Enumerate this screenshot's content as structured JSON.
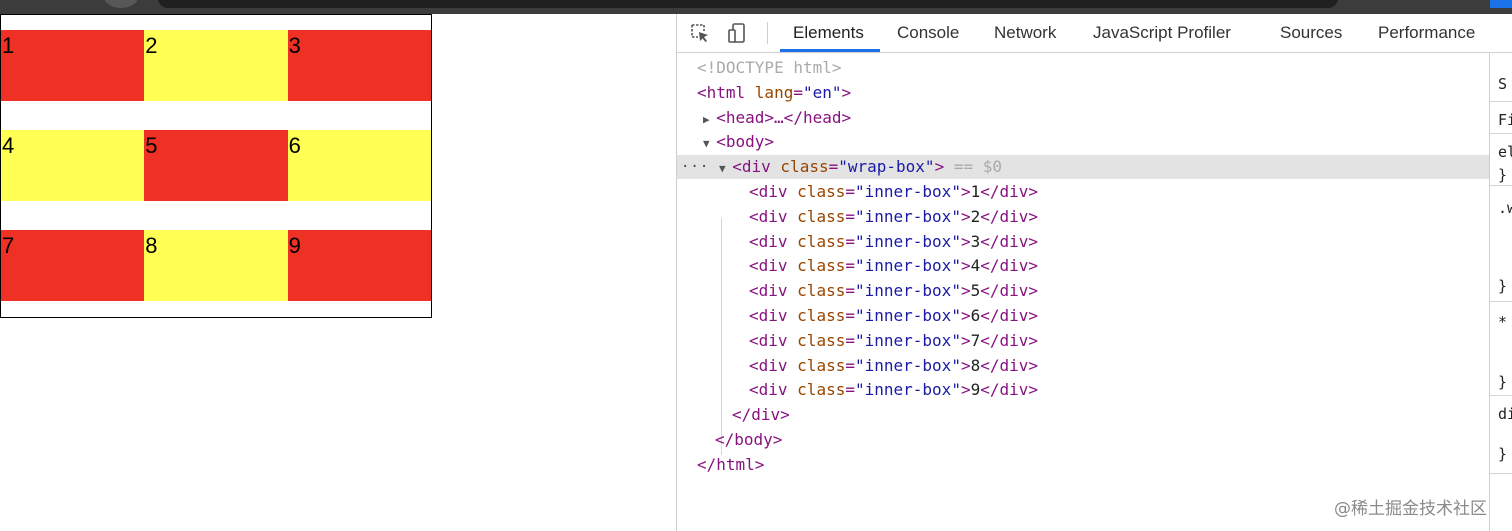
{
  "preview": {
    "rows": [
      [
        {
          "label": "1",
          "color": "red"
        },
        {
          "label": "2",
          "color": "yellow"
        },
        {
          "label": "3",
          "color": "red"
        }
      ],
      [
        {
          "label": "4",
          "color": "yellow"
        },
        {
          "label": "5",
          "color": "red"
        },
        {
          "label": "6",
          "color": "yellow"
        }
      ],
      [
        {
          "label": "7",
          "color": "red"
        },
        {
          "label": "8",
          "color": "yellow"
        },
        {
          "label": "9",
          "color": "red"
        }
      ]
    ],
    "colors": {
      "red": "#ee3124",
      "yellow": "#ffff54"
    }
  },
  "devtools": {
    "tabs": [
      {
        "label": "Elements",
        "active": true
      },
      {
        "label": "Console"
      },
      {
        "label": "Network"
      },
      {
        "label": "JavaScript Profiler"
      },
      {
        "label": "Sources"
      },
      {
        "label": "Performance"
      }
    ],
    "toolbar_icons": [
      "inspect-element-icon",
      "device-toolbar-icon"
    ],
    "dom": {
      "doctype": "<!DOCTYPE html>",
      "html_open": {
        "tag": "html",
        "attr": "lang",
        "value": "\"en\""
      },
      "head": "<head>…</head>",
      "body_open": "<body>",
      "wrap_div": {
        "tag": "div",
        "attr": "class",
        "value": "\"wrap-box\"",
        "marker": "== $0"
      },
      "children": [
        {
          "tag": "div",
          "attr": "class",
          "value": "\"inner-box\"",
          "text": "1"
        },
        {
          "tag": "div",
          "attr": "class",
          "value": "\"inner-box\"",
          "text": "2"
        },
        {
          "tag": "div",
          "attr": "class",
          "value": "\"inner-box\"",
          "text": "3"
        },
        {
          "tag": "div",
          "attr": "class",
          "value": "\"inner-box\"",
          "text": "4"
        },
        {
          "tag": "div",
          "attr": "class",
          "value": "\"inner-box\"",
          "text": "5"
        },
        {
          "tag": "div",
          "attr": "class",
          "value": "\"inner-box\"",
          "text": "6"
        },
        {
          "tag": "div",
          "attr": "class",
          "value": "\"inner-box\"",
          "text": "7"
        },
        {
          "tag": "div",
          "attr": "class",
          "value": "\"inner-box\"",
          "text": "8"
        },
        {
          "tag": "div",
          "attr": "class",
          "value": "\"inner-box\"",
          "text": "9"
        }
      ],
      "div_close": "</div>",
      "body_close": "</body>",
      "html_close": "</html>"
    },
    "side_pane": [
      "S",
      "Fi",
      "el",
      "}",
      ".w",
      "}",
      "*",
      "}",
      "di",
      "}"
    ]
  },
  "watermark": "@稀土掘金技术社区",
  "accent_color": "#1a73e8"
}
